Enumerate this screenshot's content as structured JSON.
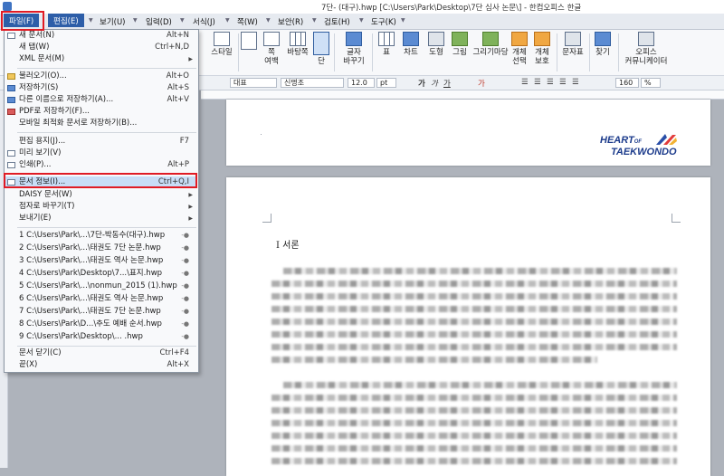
{
  "window": {
    "title": "7단-      (대구).hwp [C:\\Users\\Park\\Desktop\\7단 심사 논문\\] - 한컴오피스 한글"
  },
  "menubar": {
    "items": [
      {
        "label": "파일(F)"
      },
      {
        "label": "편집(E)"
      },
      {
        "label": "보기(U)"
      },
      {
        "label": "입력(D)"
      },
      {
        "label": "서식(J)"
      },
      {
        "label": "쪽(W)"
      },
      {
        "label": "보안(R)"
      },
      {
        "label": "검토(H)"
      },
      {
        "label": "도구(K)"
      }
    ]
  },
  "ribbon": {
    "buttons": [
      {
        "label": "스타일",
        "icon": "styles-icon"
      },
      {
        "label": "쪽\n여백",
        "icon": "page-margin-icon"
      },
      {
        "label": "바탕쪽",
        "icon": "master-page-icon"
      },
      {
        "label": "단",
        "icon": "columns-icon"
      },
      {
        "label": "글자\n바꾸기",
        "icon": "change-char-icon"
      },
      {
        "label": "표",
        "icon": "table-icon"
      },
      {
        "label": "차트",
        "icon": "chart-icon"
      },
      {
        "label": "도형",
        "icon": "shape-icon"
      },
      {
        "label": "그림",
        "icon": "picture-icon"
      },
      {
        "label": "그리기마당",
        "icon": "clipart-icon"
      },
      {
        "label": "개체\n선택",
        "icon": "object-select-icon"
      },
      {
        "label": "개체\n보호",
        "icon": "object-protect-icon"
      },
      {
        "label": "문자표",
        "icon": "symbol-icon"
      },
      {
        "label": "찾기",
        "icon": "find-icon"
      },
      {
        "label": "오피스\n커뮤니케이터",
        "icon": "office-communicator-icon"
      }
    ]
  },
  "formatbar": {
    "style": "대표",
    "font": "신명조",
    "size": "12.0",
    "unit": "pt",
    "zoom": "160",
    "zoom_unit": "%",
    "bold": "가",
    "italic": "가",
    "underline": "가"
  },
  "file_menu": {
    "items": [
      {
        "label": "새 문서(N)",
        "shortcut": "Alt+N"
      },
      {
        "label": "새 탭(W)",
        "shortcut": "Ctrl+N,D"
      },
      {
        "label": "XML 문서(M)",
        "shortcut": ""
      },
      {
        "label": "불러오기(O)...",
        "shortcut": "Alt+O"
      },
      {
        "label": "저장하기(S)",
        "shortcut": "Alt+S"
      },
      {
        "label": "다른 이름으로 저장하기(A)...",
        "shortcut": "Alt+V"
      },
      {
        "label": "PDF로 저장하기(F)...",
        "shortcut": ""
      },
      {
        "label": "모바일 최적화 문서로 저장하기(B)...",
        "shortcut": ""
      },
      {
        "label": "편집 용지(J)...",
        "shortcut": "F7"
      },
      {
        "label": "미리 보기(V)",
        "shortcut": ""
      },
      {
        "label": "인쇄(P)...",
        "shortcut": "Alt+P"
      },
      {
        "label": "문서 정보(I)...",
        "shortcut": "Ctrl+Q,I"
      },
      {
        "label": "DAISY 문서(W)",
        "shortcut": ""
      },
      {
        "label": "점자로 바꾸기(T)",
        "shortcut": ""
      },
      {
        "label": "보내기(E)",
        "shortcut": ""
      }
    ],
    "recent": [
      "1 C:\\Users\\Park\\...\\7단-박동수(대구).hwp",
      "2 C:\\Users\\Park\\...\\태권도 7단 논문.hwp",
      "3 C:\\Users\\Park\\...\\태권도 역사 논문.hwp",
      "4 C:\\Users\\Park\\Desktop\\7...\\표지.hwp",
      "5 C:\\Users\\Park\\...\\nonmun_2015 (1).hwp",
      "6 C:\\Users\\Park\\...\\태권도 역사 논문.hwp",
      "7 C:\\Users\\Park\\...\\태권도 7단 논문.hwp",
      "8 C:\\Users\\Park\\D...\\추도 예배 순서.hwp",
      "9 C:\\Users\\Park\\Desktop\\...          .hwp"
    ],
    "close": {
      "label": "문서 닫기(C)",
      "shortcut": "Ctrl+F4"
    },
    "exit": {
      "label": "끝(X)",
      "shortcut": "Alt+X"
    }
  },
  "document": {
    "logo_line1": "HEART",
    "logo_of": "OF",
    "logo_line2": "TAEKWONDO",
    "heading": "Ⅰ 서론"
  },
  "colors": {
    "accent": "#2d5ea8",
    "highlight_box": "#e01b24",
    "menu_hover": "#c8ddf6"
  }
}
